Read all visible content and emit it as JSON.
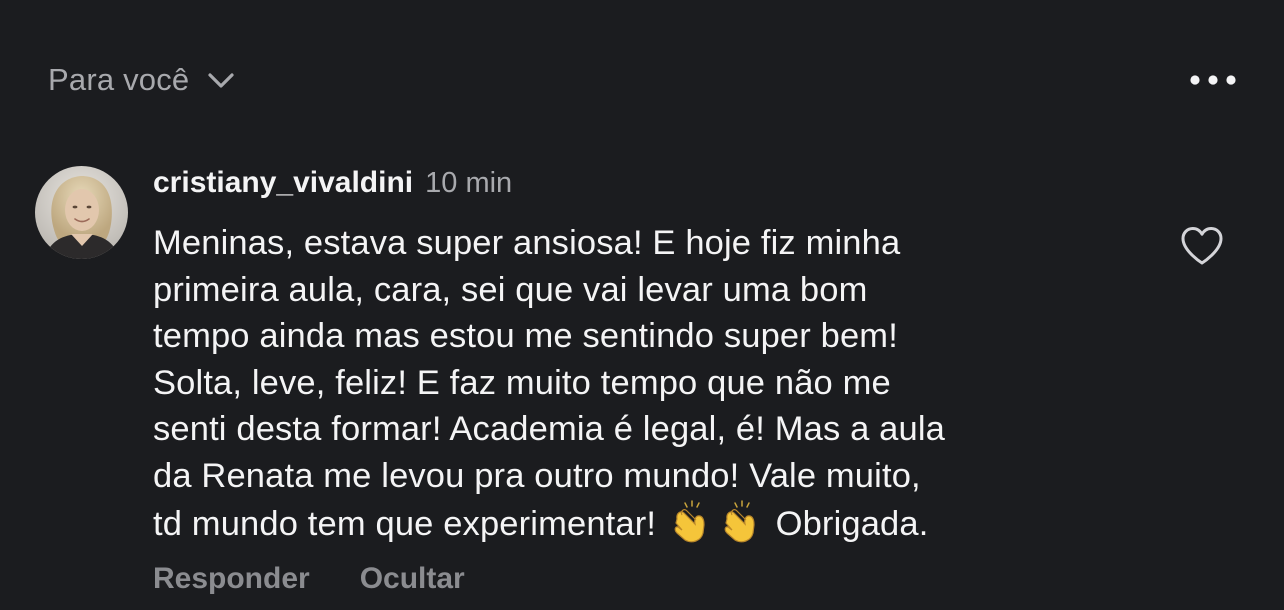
{
  "header": {
    "feed_filter_label": "Para você",
    "chevron_icon": "chevron-down-icon",
    "more_icon": "more-horizontal-icon"
  },
  "comment": {
    "username": "cristiany_vivaldini",
    "timestamp": "10 min",
    "lines": [
      "Meninas, estava super ansiosa! E hoje fiz minha",
      "primeira aula, cara, sei que vai levar uma bom",
      "tempo ainda mas estou me sentindo super bem!",
      "Solta, leve, feliz! E faz muito tempo que não me",
      "senti desta formar! Academia é legal, é! Mas a aula",
      "da Renata me levou pra outro mundo! Vale muito,"
    ],
    "last_line_start": "td mundo tem que experimentar!",
    "last_line_end": "Obrigada.",
    "emoji": [
      "clapping-hands-emoji",
      "clapping-hands-emoji"
    ],
    "like_icon": "heart-outline-icon"
  },
  "actions": {
    "reply_label": "Responder",
    "hide_label": "Ocultar"
  },
  "colors": {
    "background": "#1b1c1f",
    "primary_text": "#f4f4f5",
    "secondary_text": "#a8a9ad",
    "action_text": "#8b8c90"
  }
}
